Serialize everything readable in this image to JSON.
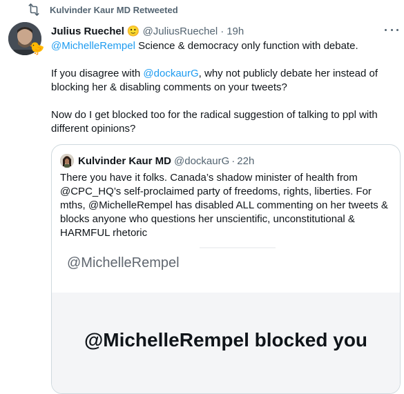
{
  "retweet_banner": {
    "text": "Kulvinder Kaur MD Retweeted"
  },
  "tweet": {
    "author_name": "Julius Ruechel",
    "author_emoji": "🙂",
    "author_handle": "@JuliusRuechel",
    "time": "19h",
    "paragraphs": {
      "p1": {
        "mention": "@MichelleRempel",
        "text": " Science & democracy only function with debate."
      },
      "p2": {
        "pre": "If you disagree with ",
        "mention": "@dockaurG",
        "post": ", why not publicly debate her instead of blocking her & disabling comments on your tweets?"
      },
      "p3": {
        "text": "Now do I get blocked too for the radical suggestion of talking to ppl with different opinions?"
      }
    }
  },
  "quoted_tweet": {
    "author_name": "Kulvinder Kaur MD",
    "author_handle": "@dockaurG",
    "time": "22h",
    "text": "There you have it folks. Canada’s shadow minister of health from @CPC_HQ’s self-proclaimed party of freedoms, rights, liberties. For mths, @MichelleRempel has disabled ALL commenting on her tweets & blocks anyone who questions her unscientific, unconstitutional & HARMFUL rhetoric",
    "image": {
      "handle": "@MichelleRempel",
      "blocked_text": "@MichelleRempel blocked you"
    }
  },
  "colors": {
    "link": "#1d9bf0",
    "secondary": "#536471",
    "border": "#cfd9de"
  },
  "icons": [
    "retweet-icon",
    "more-icon"
  ]
}
